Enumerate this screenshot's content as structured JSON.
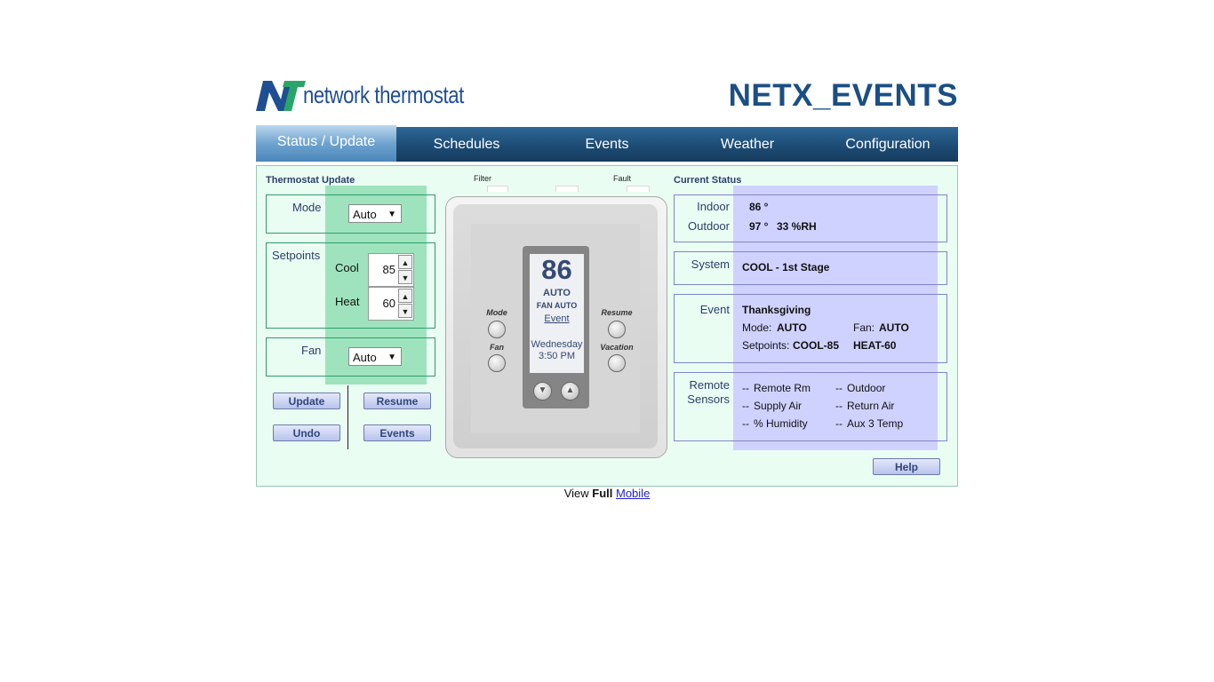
{
  "header": {
    "logo_text": "network thermostat",
    "logo_mark": "NT",
    "site_title": "NETX_EVENTS"
  },
  "nav": {
    "tabs": [
      {
        "label": "Status / Update",
        "active": true
      },
      {
        "label": "Schedules",
        "active": false
      },
      {
        "label": "Events",
        "active": false
      },
      {
        "label": "Weather",
        "active": false
      },
      {
        "label": "Configuration",
        "active": false
      }
    ]
  },
  "update": {
    "title": "Thermostat Update",
    "mode_label": "Mode",
    "mode_value": "Auto",
    "setpoints_label": "Setpoints",
    "cool_label": "Cool",
    "cool_value": "85",
    "heat_label": "Heat",
    "heat_value": "60",
    "fan_label": "Fan",
    "fan_value": "Auto",
    "buttons": {
      "update": "Update",
      "resume": "Resume",
      "undo": "Undo",
      "events": "Events"
    }
  },
  "device": {
    "filter_label": "Filter",
    "fault_label": "Fault",
    "temp": "86",
    "mode": "AUTO",
    "fan": "FAN AUTO",
    "event_link": "Event",
    "day": "Wednesday",
    "time": "3:50 PM",
    "left_buttons": [
      "Mode",
      "Fan"
    ],
    "right_buttons": [
      "Resume",
      "Vacation"
    ]
  },
  "status": {
    "title": "Current Status",
    "indoor_label": "Indoor",
    "indoor_value": "86 °",
    "outdoor_label": "Outdoor",
    "outdoor_temp": "97 °",
    "outdoor_rh": "33 %RH",
    "system_label": "System",
    "system_value": "COOL - 1st Stage",
    "event_label": "Event",
    "event_name": "Thanksgiving",
    "mode_key": "Mode:",
    "mode_val": "AUTO",
    "fan_key": "Fan:",
    "fan_val": "AUTO",
    "setpoints_key": "Setpoints:",
    "setpoints_cool": "COOL-85",
    "setpoints_heat": "HEAT-60",
    "remote_label_1": "Remote",
    "remote_label_2": "Sensors",
    "sensors": [
      {
        "value": "--",
        "name": "Remote Rm"
      },
      {
        "value": "--",
        "name": "Outdoor"
      },
      {
        "value": "--",
        "name": "Supply Air"
      },
      {
        "value": "--",
        "name": "Return Air"
      },
      {
        "value": "--",
        "name": "% Humidity"
      },
      {
        "value": "--",
        "name": "Aux 3 Temp"
      }
    ],
    "help_button": "Help"
  },
  "footer": {
    "view": "View",
    "full": "Full",
    "mobile": "Mobile"
  },
  "colors": {
    "nav_dark": "#1c4a72",
    "nav_active": "#6fa3cf",
    "panel_bg": "#eafdf3",
    "green_highlight": "#9ee3bd",
    "blue_highlight": "#cfd2ff",
    "title_blue": "#1b4f84"
  }
}
